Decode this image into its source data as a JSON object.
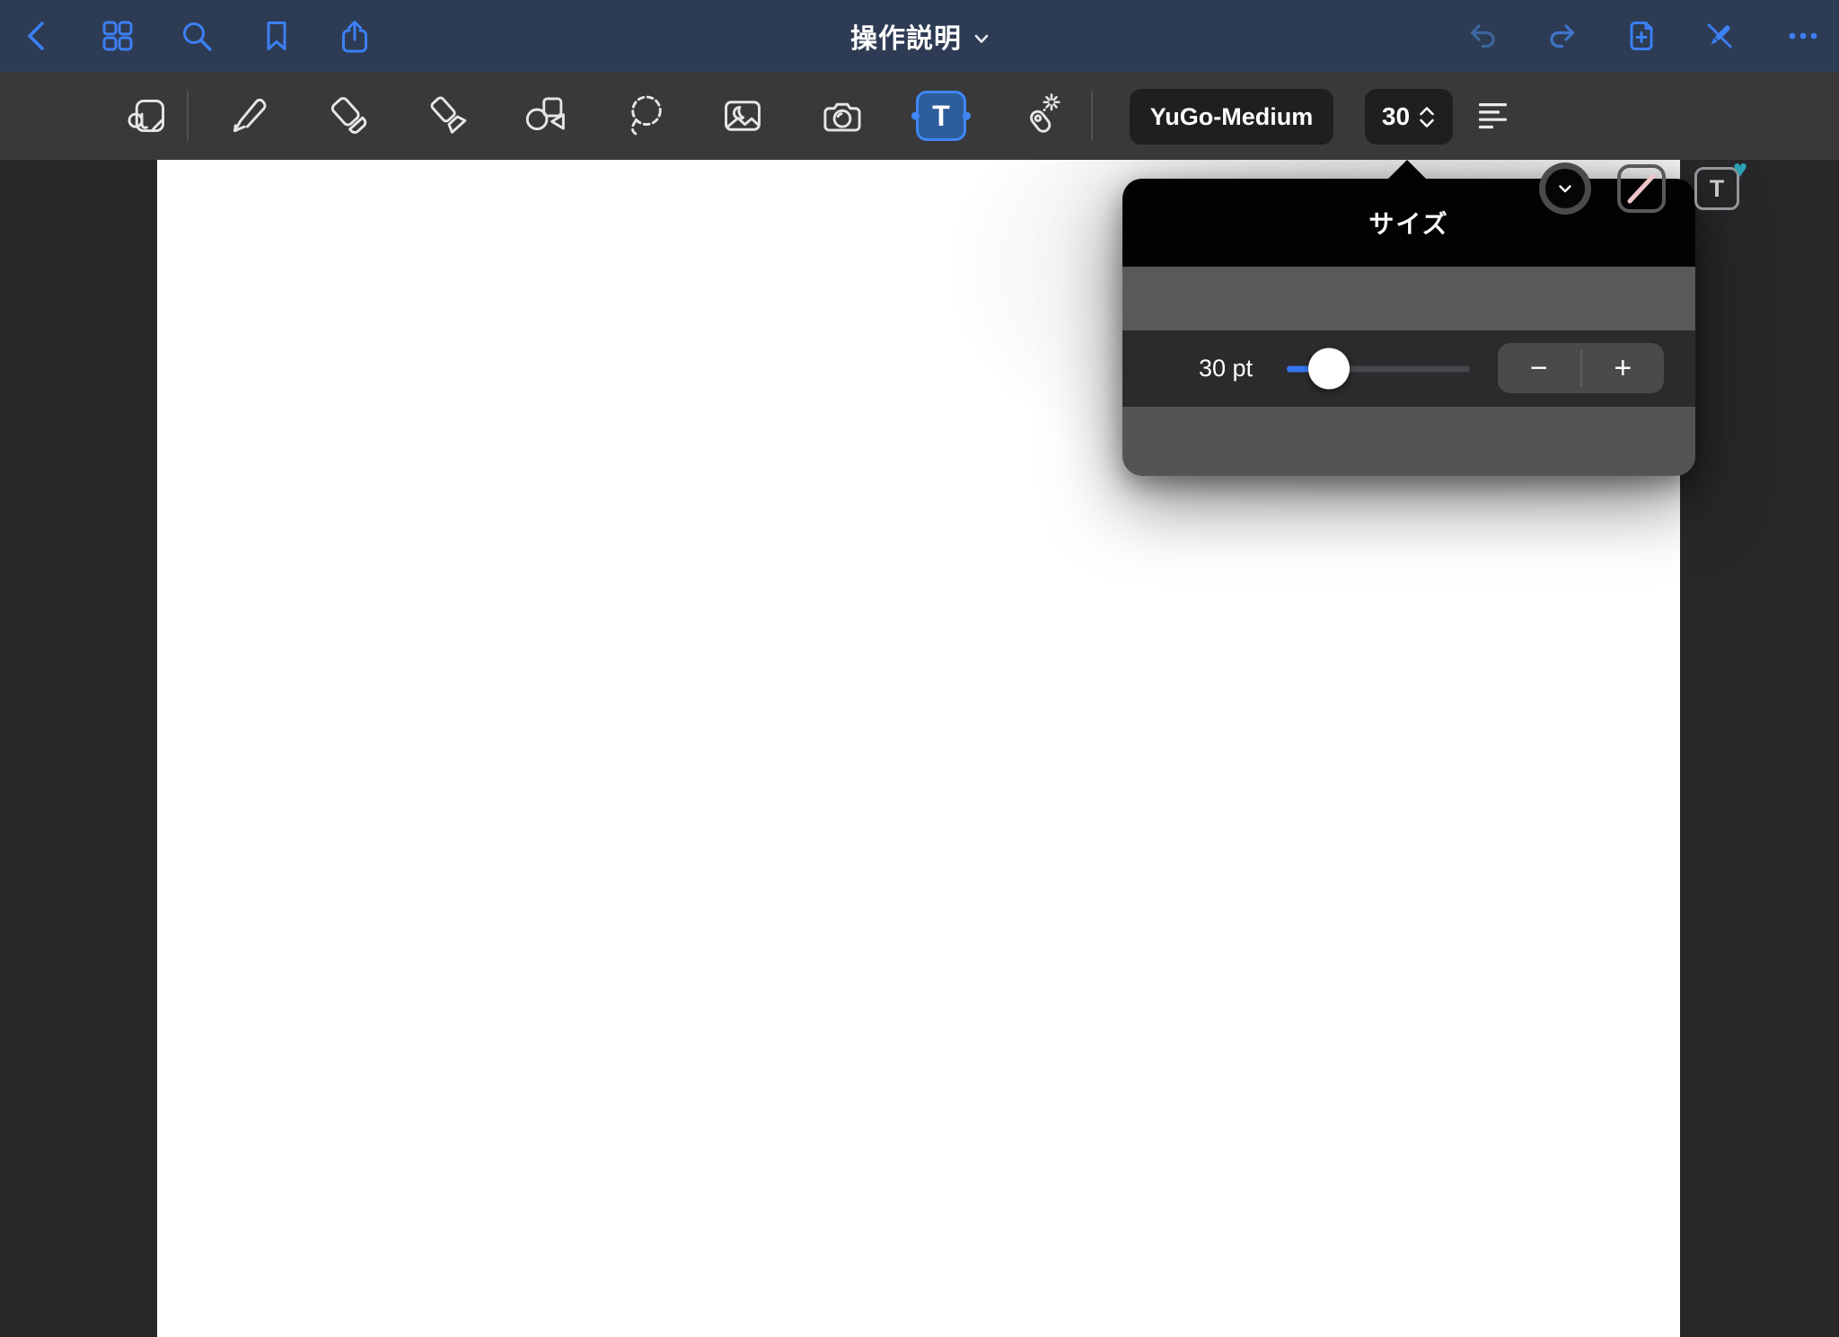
{
  "window": {
    "title": "操作説明"
  },
  "top_bar": {
    "title": "操作説明",
    "left_icons": [
      "back",
      "thumbnails-grid",
      "search",
      "bookmark",
      "share"
    ],
    "right_icons": [
      "undo",
      "redo",
      "add-page",
      "pen-cross",
      "more"
    ]
  },
  "toolbar": {
    "tools": [
      "handwriting",
      "pen",
      "eraser",
      "highlighter",
      "shapes",
      "lasso",
      "image",
      "camera",
      "text",
      "laser-pointer"
    ],
    "selected_tool": "text",
    "text_tool_glyph": "T",
    "font_name": "YuGo-Medium",
    "font_size": "30"
  },
  "size_popover": {
    "title": "サイズ",
    "size_label": "30 pt",
    "slider_value": 30,
    "slider_percent": 23,
    "minus_label": "−",
    "plus_label": "+"
  },
  "colors": {
    "top_bar_navy": "#2d3c54",
    "accent_blue": "#3d7ff5",
    "slider_blue": "#3577f0",
    "heart_teal": "#2b9fb3",
    "stroke_pink": "#efc6c8",
    "text_tool_fill": "#2d5d9b"
  }
}
